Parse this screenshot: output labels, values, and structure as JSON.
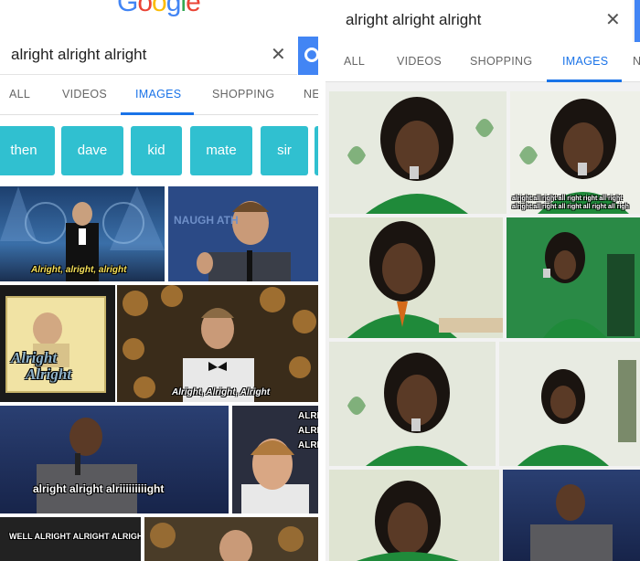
{
  "left": {
    "logo": "Google",
    "search": {
      "query": "alright alright alright"
    },
    "tabs": [
      {
        "label": "ALL"
      },
      {
        "label": "VIDEOS"
      },
      {
        "label": "IMAGES"
      },
      {
        "label": "SHOPPING"
      },
      {
        "label": "NE"
      }
    ],
    "active_tab_index": 2,
    "chips": [
      {
        "label": "then"
      },
      {
        "label": "dave"
      },
      {
        "label": "kid"
      },
      {
        "label": "mate"
      },
      {
        "label": "sir"
      }
    ],
    "captions": {
      "img1": "Alright, alright, alright",
      "img3": "Alright",
      "img3b": "Alright",
      "img4": "Alright, Alright, Alright",
      "img5": "alright alright alriiiiiiiiight",
      "img6a": "ALRI",
      "img6b": "ALRI",
      "img6c": "ALRI",
      "img7": "WELL ALRIGHT ALRIGHT ALRIGHT",
      "img2": "NAUGH    ATH"
    }
  },
  "right": {
    "search": {
      "query": "alright alright alright"
    },
    "tabs": [
      {
        "label": "ALL"
      },
      {
        "label": "VIDEOS"
      },
      {
        "label": "SHOPPING"
      },
      {
        "label": "IMAGES"
      },
      {
        "label": "N"
      }
    ],
    "active_tab_index": 3,
    "captions": {
      "r2a": "alright all right all right right all right",
      "r2b": "alright all right all right all right all righ"
    }
  },
  "colors": {
    "google_blue": "#4285f4",
    "active_tab": "#1a73e8",
    "chip_bg": "#30c0d0",
    "green_shirt": "#1f8a3a"
  },
  "icons": {
    "clear": "close-icon",
    "search": "search-icon"
  }
}
